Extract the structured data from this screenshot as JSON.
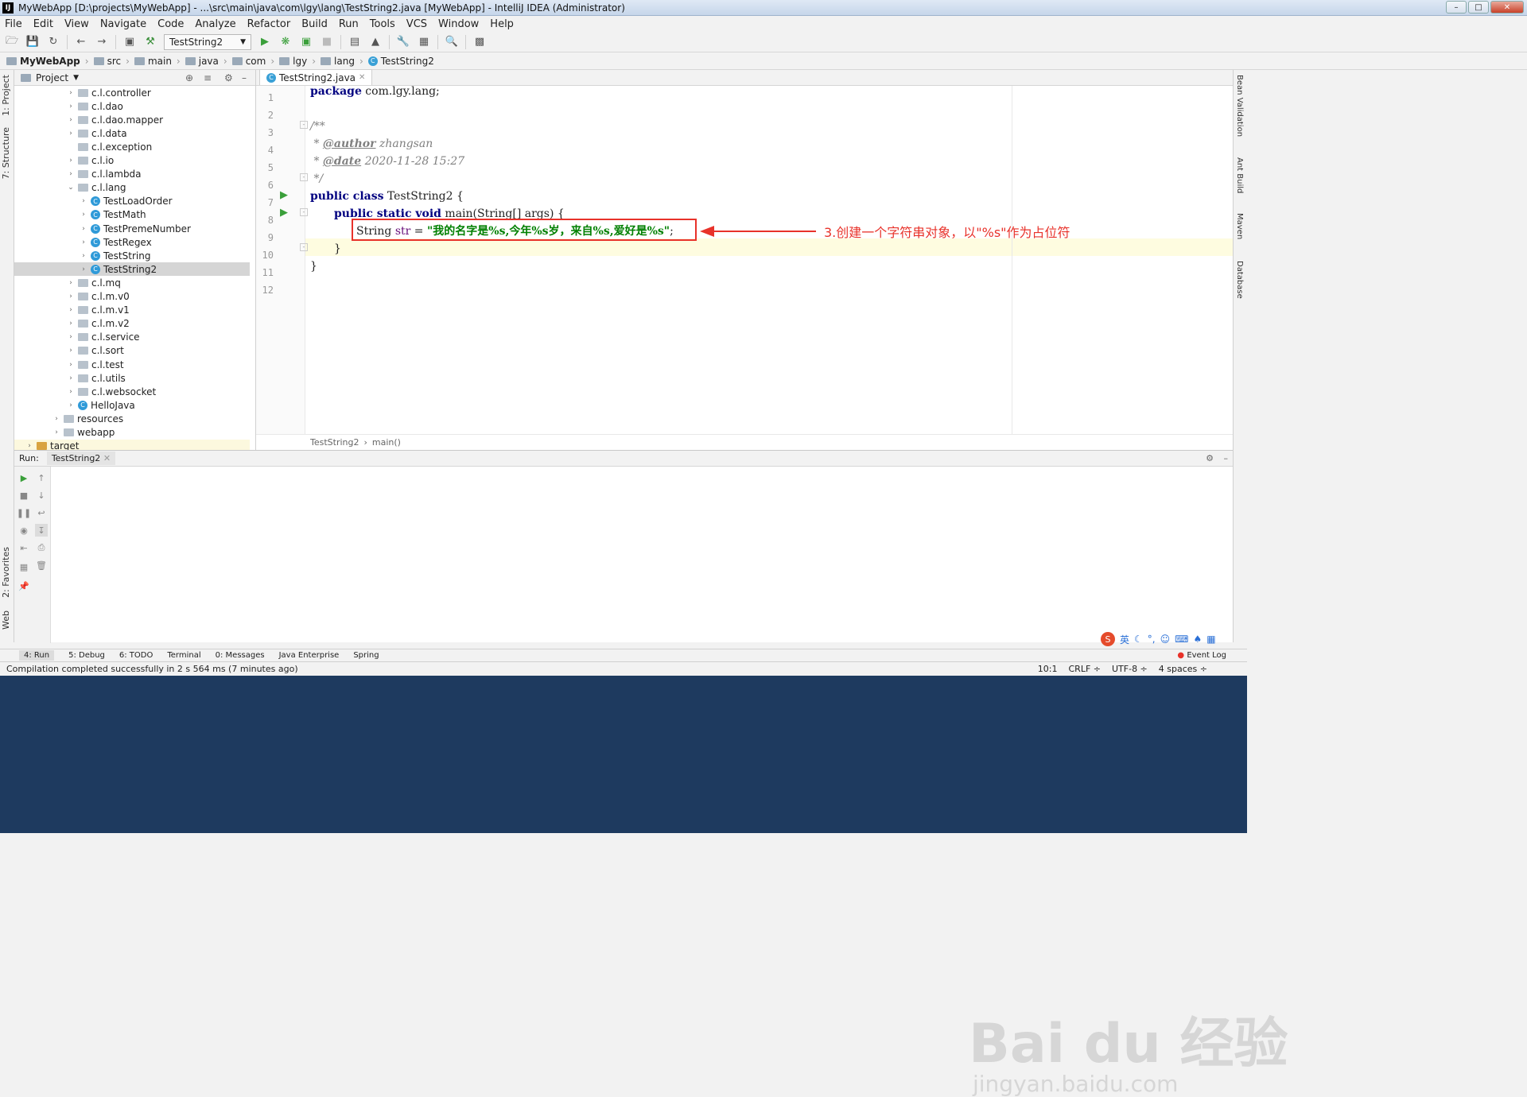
{
  "window": {
    "title": "MyWebApp [D:\\projects\\MyWebApp] - ...\\src\\main\\java\\com\\lgy\\lang\\TestString2.java [MyWebApp] - IntelliJ IDEA (Administrator)",
    "app_icon": "IJ"
  },
  "menu": [
    "File",
    "Edit",
    "View",
    "Navigate",
    "Code",
    "Analyze",
    "Refactor",
    "Build",
    "Run",
    "Tools",
    "VCS",
    "Window",
    "Help"
  ],
  "toolbar": {
    "run_config": "TestString2"
  },
  "breadcrumb": [
    "MyWebApp",
    "src",
    "main",
    "java",
    "com",
    "lgy",
    "lang",
    "TestString2"
  ],
  "left_tools": [
    "1: Project",
    "7: Structure",
    "2: Favorites",
    "Web"
  ],
  "project": {
    "header": "Project",
    "items": [
      {
        "label": "c.l.controller",
        "type": "pkg"
      },
      {
        "label": "c.l.dao",
        "type": "pkg"
      },
      {
        "label": "c.l.dao.mapper",
        "type": "pkg"
      },
      {
        "label": "c.l.data",
        "type": "pkg"
      },
      {
        "label": "c.l.exception",
        "type": "pkg"
      },
      {
        "label": "c.l.io",
        "type": "pkg"
      },
      {
        "label": "c.l.lambda",
        "type": "pkg"
      },
      {
        "label": "c.l.lang",
        "type": "pkg"
      },
      {
        "label": "TestLoadOrder",
        "type": "cls"
      },
      {
        "label": "TestMath",
        "type": "cls"
      },
      {
        "label": "TestPremeNumber",
        "type": "cls"
      },
      {
        "label": "TestRegex",
        "type": "cls"
      },
      {
        "label": "TestString",
        "type": "cls"
      },
      {
        "label": "TestString2",
        "type": "cls"
      },
      {
        "label": "c.l.mq",
        "type": "pkg"
      },
      {
        "label": "c.l.m.v0",
        "type": "pkg"
      },
      {
        "label": "c.l.m.v1",
        "type": "pkg"
      },
      {
        "label": "c.l.m.v2",
        "type": "pkg"
      },
      {
        "label": "c.l.service",
        "type": "pkg"
      },
      {
        "label": "c.l.sort",
        "type": "pkg"
      },
      {
        "label": "c.l.test",
        "type": "pkg"
      },
      {
        "label": "c.l.utils",
        "type": "pkg"
      },
      {
        "label": "c.l.websocket",
        "type": "pkg"
      },
      {
        "label": "HelloJava",
        "type": "cls"
      },
      {
        "label": "resources",
        "type": "pkg"
      },
      {
        "label": "webapp",
        "type": "pkg"
      },
      {
        "label": "target",
        "type": "folder"
      }
    ]
  },
  "editor": {
    "tab": "TestString2.java",
    "line_numbers": [
      "1",
      "2",
      "3",
      "4",
      "5",
      "6",
      "7",
      "8",
      "9",
      "10",
      "11",
      "12"
    ],
    "code": {
      "l1_kw": "package",
      "l1_rest": " com.lgy.lang;",
      "l3": "/**",
      "l4_pre": " * ",
      "l4_tag": "@author",
      "l4_post": " zhangsan",
      "l5_pre": " * ",
      "l5_tag": "@date",
      "l5_post": " 2020-11-28 15:27",
      "l6": " */",
      "l7_kw": "public class",
      "l7_rest": " TestString2 {",
      "l8_kw": "public static void",
      "l8_rest": " main(String[] args) {",
      "l9_type": "String ",
      "l9_var": "str",
      "l9_eq": " = ",
      "l9_str": "\"我的名字是%s,今年%s岁，来自%s,爱好是%s\"",
      "l9_end": ";",
      "l10": "}",
      "l11": "}"
    },
    "bottom_breadcrumb": [
      "TestString2",
      "main()"
    ]
  },
  "annotation": "3.创建一个字符串对象，以\"%s\"作为占位符",
  "right_tools": [
    "Bean Validation",
    "Ant Build",
    "Maven",
    "Database"
  ],
  "run": {
    "label": "Run:",
    "tab": "TestString2"
  },
  "bottom_tabs": [
    "4: Run",
    "5: Debug",
    "6: TODO",
    "Terminal",
    "0: Messages",
    "Java Enterprise",
    "Spring"
  ],
  "event_log": "Event Log",
  "status": {
    "message": "Compilation completed successfully in 2 s 564 ms (7 minutes ago)",
    "position": "10:1",
    "line_sep": "CRLF ÷",
    "encoding": "UTF-8 ÷",
    "indent": "4 spaces ÷"
  },
  "watermark": {
    "main": "Bai du 经验",
    "sub": "jingyan.baidu.com"
  },
  "ime": {
    "lang": "英"
  }
}
